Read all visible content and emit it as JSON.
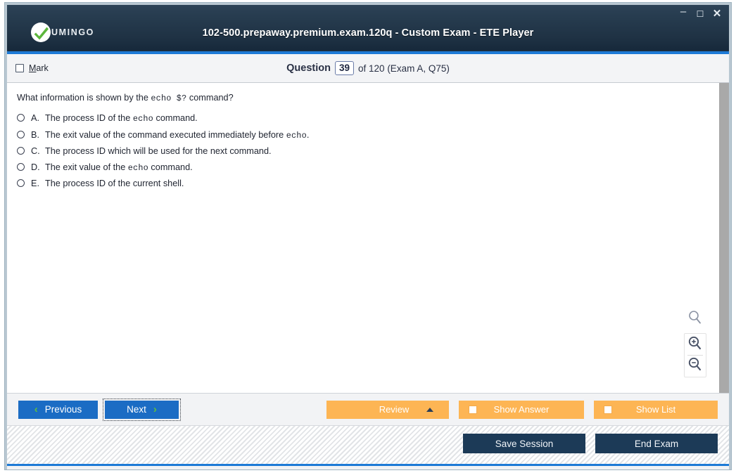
{
  "window": {
    "title": "102-500.prepaway.premium.exam.120q - Custom Exam - ETE Player",
    "logo_text": "UMINGO",
    "controls": {
      "minimize": "–",
      "maximize": "☐",
      "close": "✕"
    }
  },
  "question_header": {
    "mark_label_prefix": "",
    "mark_label": "Mark",
    "question_word": "Question",
    "question_number": "39",
    "rest": "of 120 (Exam A, Q75)"
  },
  "question": {
    "text_before": "What information is shown by the ",
    "code": "echo  $?",
    "text_after": " command?",
    "options": [
      {
        "letter": "A.",
        "parts": [
          {
            "type": "text",
            "value": "The process ID of the "
          },
          {
            "type": "code",
            "value": "echo"
          },
          {
            "type": "text",
            "value": " command."
          }
        ],
        "plain": "The process ID of the echo command."
      },
      {
        "letter": "B.",
        "parts": [
          {
            "type": "text",
            "value": "The exit value of the command executed immediately before "
          },
          {
            "type": "code",
            "value": "echo"
          },
          {
            "type": "text",
            "value": "."
          }
        ],
        "plain": "The exit value of the command executed immediately before echo."
      },
      {
        "letter": "C.",
        "parts": [
          {
            "type": "text",
            "value": "The process ID which will be used for the next command."
          }
        ],
        "plain": "The process ID which will be used for the next command."
      },
      {
        "letter": "D.",
        "parts": [
          {
            "type": "text",
            "value": "The exit value of the "
          },
          {
            "type": "code",
            "value": "echo"
          },
          {
            "type": "text",
            "value": "  command."
          }
        ],
        "plain": "The exit value of the echo  command."
      },
      {
        "letter": "E.",
        "parts": [
          {
            "type": "text",
            "value": "The process ID of the current shell."
          }
        ],
        "plain": "The process ID of the current shell."
      }
    ],
    "selected": null
  },
  "zoom_controls": {
    "search_icon": "magnifier-icon",
    "zoom_in_icon": "magnifier-plus-icon",
    "zoom_out_icon": "magnifier-minus-icon"
  },
  "nav": {
    "previous": "Previous",
    "next": "Next",
    "prev_chevron": "‹",
    "next_chevron": "›"
  },
  "actions": {
    "review": "Review",
    "show_answer": "Show Answer",
    "show_list": "Show List",
    "show_answer_checked": false,
    "show_list_checked": false
  },
  "footer": {
    "save_session": "Save Session",
    "end_exam": "End Exam"
  },
  "colors": {
    "titlebar_dark": "#1f3244",
    "accent_blue": "#1d7ad6",
    "nav_blue": "#1b6cc4",
    "orange": "#fdb554",
    "dark_button": "#1c3a57",
    "green_check": "#5cb63c"
  }
}
